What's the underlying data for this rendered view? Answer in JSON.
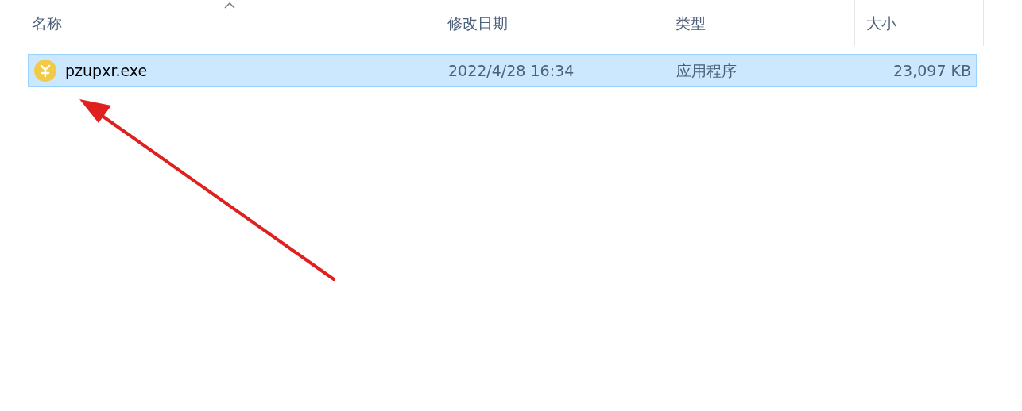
{
  "table": {
    "columns": [
      {
        "label": "名称",
        "sorted": true
      },
      {
        "label": "修改日期",
        "sorted": false
      },
      {
        "label": "类型",
        "sorted": false
      },
      {
        "label": "大小",
        "sorted": false
      }
    ],
    "rows": [
      {
        "name": "pzupxr.exe",
        "date": "2022/4/28 16:34",
        "type": "应用程序",
        "size": "23,097 KB",
        "selected": true
      }
    ]
  }
}
